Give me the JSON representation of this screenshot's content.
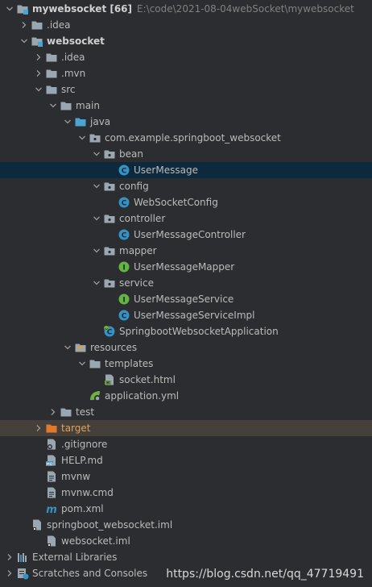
{
  "colors": {
    "background": "#2b2d30",
    "selected_row": "#0d293e",
    "excluded_row": "#45403a",
    "folder": "#9aa7b0",
    "folder_blue": "#4ba3d3",
    "folder_excluded": "#e07a2e",
    "class_icon": "#3592c4",
    "interface_icon": "#62b543",
    "text": "#bbbbbb"
  },
  "tree": [
    {
      "depth": 0,
      "arrow": "down",
      "icon": "module-folder-icon",
      "label": "mywebsocket [66]",
      "hint": "E:\\code\\2021-08-04webSocket\\mywebsocket",
      "bold": true
    },
    {
      "depth": 1,
      "arrow": "right",
      "icon": "folder-icon",
      "label": ".idea"
    },
    {
      "depth": 1,
      "arrow": "down",
      "icon": "module-folder-icon",
      "label": "websocket",
      "bold": true
    },
    {
      "depth": 2,
      "arrow": "right",
      "icon": "folder-icon",
      "label": ".idea"
    },
    {
      "depth": 2,
      "arrow": "right",
      "icon": "folder-icon",
      "label": ".mvn"
    },
    {
      "depth": 2,
      "arrow": "down",
      "icon": "folder-icon",
      "label": "src"
    },
    {
      "depth": 3,
      "arrow": "down",
      "icon": "folder-icon",
      "label": "main"
    },
    {
      "depth": 4,
      "arrow": "down",
      "icon": "source-folder-icon",
      "label": "java"
    },
    {
      "depth": 5,
      "arrow": "down",
      "icon": "package-icon",
      "label": "com.example.springboot_websocket"
    },
    {
      "depth": 6,
      "arrow": "down",
      "icon": "package-icon",
      "label": "bean"
    },
    {
      "depth": 7,
      "arrow": "none",
      "icon": "class-icon",
      "label": "UserMessage",
      "selected": true
    },
    {
      "depth": 6,
      "arrow": "down",
      "icon": "package-icon",
      "label": "config"
    },
    {
      "depth": 7,
      "arrow": "none",
      "icon": "class-icon",
      "label": "WebSocketConfig"
    },
    {
      "depth": 6,
      "arrow": "down",
      "icon": "package-icon",
      "label": "controller"
    },
    {
      "depth": 7,
      "arrow": "none",
      "icon": "class-icon",
      "label": "UserMessageController"
    },
    {
      "depth": 6,
      "arrow": "down",
      "icon": "package-icon",
      "label": "mapper"
    },
    {
      "depth": 7,
      "arrow": "none",
      "icon": "interface-icon",
      "label": "UserMessageMapper"
    },
    {
      "depth": 6,
      "arrow": "down",
      "icon": "package-icon",
      "label": "service"
    },
    {
      "depth": 7,
      "arrow": "none",
      "icon": "interface-icon",
      "label": "UserMessageService"
    },
    {
      "depth": 7,
      "arrow": "none",
      "icon": "class-icon",
      "label": "UserMessageServiceImpl"
    },
    {
      "depth": 6,
      "arrow": "none",
      "icon": "spring-boot-class-icon",
      "label": "SpringbootWebsocketApplication"
    },
    {
      "depth": 4,
      "arrow": "down",
      "icon": "resources-folder-icon",
      "label": "resources"
    },
    {
      "depth": 5,
      "arrow": "down",
      "icon": "folder-icon",
      "label": "templates"
    },
    {
      "depth": 6,
      "arrow": "none",
      "icon": "html-file-icon",
      "label": "socket.html"
    },
    {
      "depth": 5,
      "arrow": "none",
      "icon": "spring-yml-icon",
      "label": "application.yml"
    },
    {
      "depth": 3,
      "arrow": "right",
      "icon": "folder-icon",
      "label": "test"
    },
    {
      "depth": 2,
      "arrow": "right",
      "icon": "excluded-folder-icon",
      "label": "target",
      "excluded": true
    },
    {
      "depth": 2,
      "arrow": "none",
      "icon": "gitignore-icon",
      "label": ".gitignore"
    },
    {
      "depth": 2,
      "arrow": "none",
      "icon": "markdown-icon",
      "label": "HELP.md"
    },
    {
      "depth": 2,
      "arrow": "none",
      "icon": "text-file-icon",
      "label": "mvnw"
    },
    {
      "depth": 2,
      "arrow": "none",
      "icon": "text-file-icon",
      "label": "mvnw.cmd"
    },
    {
      "depth": 2,
      "arrow": "none",
      "icon": "maven-icon",
      "label": "pom.xml"
    },
    {
      "depth": 1,
      "arrow": "none",
      "icon": "iml-file-icon",
      "label": "springboot_websocket.iml"
    },
    {
      "depth": 2,
      "arrow": "none",
      "icon": "iml-file-icon",
      "label": "websocket.iml"
    },
    {
      "depth": 0,
      "arrow": "right",
      "icon": "libraries-icon",
      "label": "External Libraries"
    },
    {
      "depth": 0,
      "arrow": "right",
      "icon": "scratches-icon",
      "label": "Scratches and Consoles"
    }
  ],
  "watermark": "https://blog.csdn.net/qq_47719491"
}
